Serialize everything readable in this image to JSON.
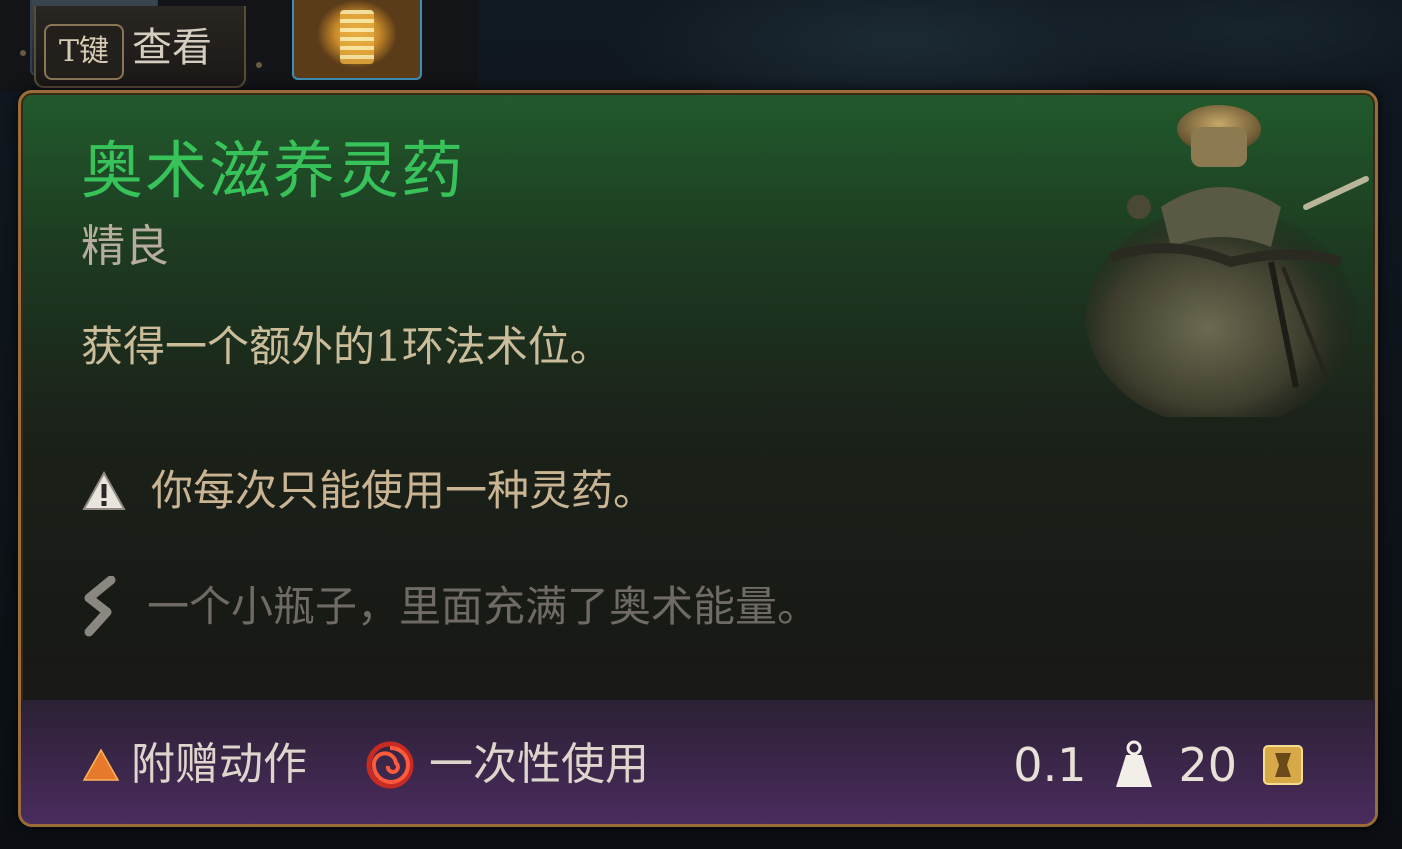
{
  "hotbar": {
    "key_hint": {
      "key": "T键",
      "label": "查看"
    }
  },
  "tooltip": {
    "title": "奥术滋养灵药",
    "rarity": "精良",
    "effect": "获得一个额外的1环法术位。",
    "warning": "你每次只能使用一种灵药。",
    "flavor": "一个小瓶子，里面充满了奥术能量。",
    "footer": {
      "action_type": "附赠动作",
      "usage": "一次性使用",
      "weight": "0.1",
      "value": "20"
    },
    "icons": {
      "action": "triangle-icon",
      "usage": "spiral-icon",
      "warning": "warning-icon",
      "flavor": "quill-icon",
      "weight": "weight-icon",
      "value": "coin-icon",
      "item": "potion-pouch-icon"
    }
  },
  "colors": {
    "title": "#37c25a",
    "border": "#9a6c3a",
    "action_triangle": "#e77a2a",
    "usage_spiral": "#d0302a"
  }
}
